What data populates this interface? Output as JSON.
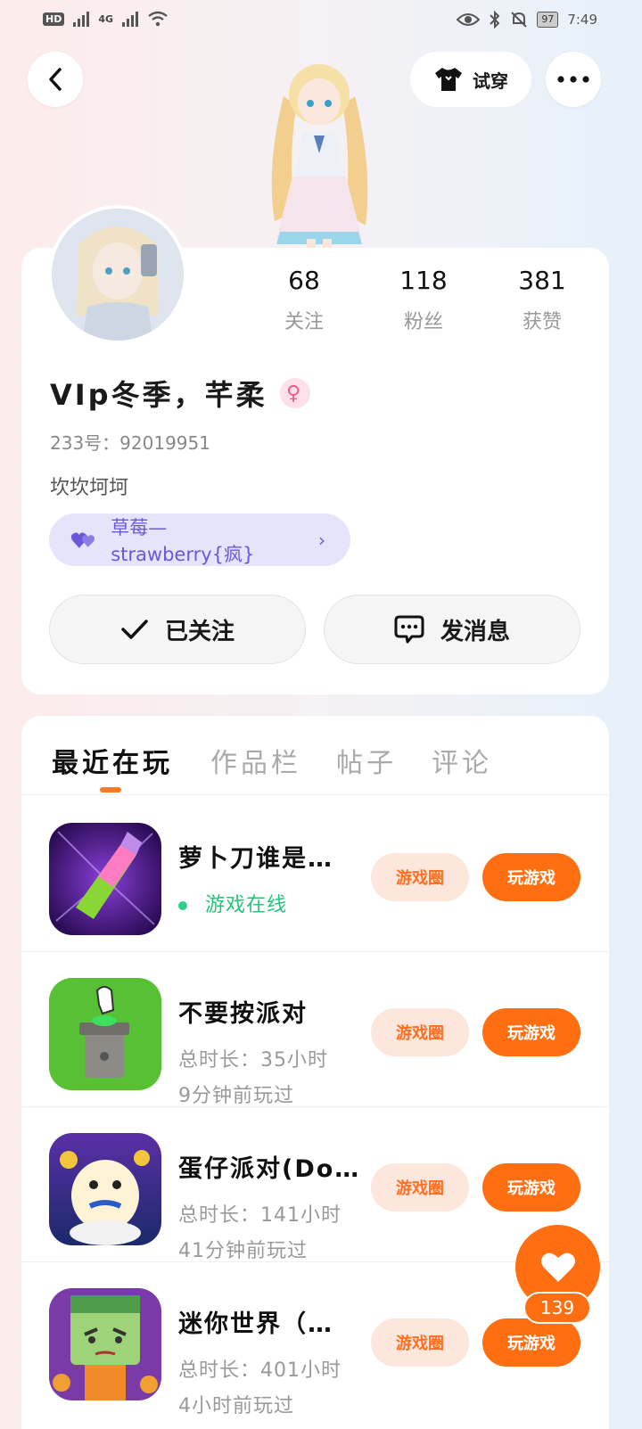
{
  "status_bar": {
    "hd_label": "HD",
    "network_label": "4G",
    "battery": "97",
    "time": "7:49"
  },
  "header": {
    "try_on_label": "试穿"
  },
  "profile": {
    "stats": [
      {
        "value": "68",
        "label": "关注"
      },
      {
        "value": "118",
        "label": "粉丝"
      },
      {
        "value": "381",
        "label": "获赞"
      }
    ],
    "nickname": "VIp冬季，芊柔",
    "gender_symbol": "♀",
    "uid": "233号：92019951",
    "bio": "坎坎坷坷",
    "club": "草莓—strawberry{疯}",
    "follow_label": "已关注",
    "message_label": "发消息"
  },
  "tabs": [
    "最近在玩",
    "作品栏",
    "帖子",
    "评论"
  ],
  "games": [
    {
      "title": "萝卜刀谁是…",
      "status": "游戏在线",
      "last_played": ""
    },
    {
      "title": "不要按派对",
      "status": "总时长：35小时",
      "last_played": "9分钟前玩过"
    },
    {
      "title": "蛋仔派对(Do…",
      "status": "总时长：141小时",
      "last_played": "41分钟前玩过"
    },
    {
      "title": "迷你世界（…",
      "status": "总时长：401小时",
      "last_played": "4小时前玩过"
    }
  ],
  "game_buttons": {
    "circle_label": "游戏圈",
    "play_label": "玩游戏"
  },
  "fab": {
    "count": "139"
  },
  "colors": {
    "accent": "#ff6f12",
    "accent_light": "#fde6dc",
    "club_bg": "#e6e4fb",
    "club_text": "#6a58d8",
    "online": "#22c57a"
  }
}
